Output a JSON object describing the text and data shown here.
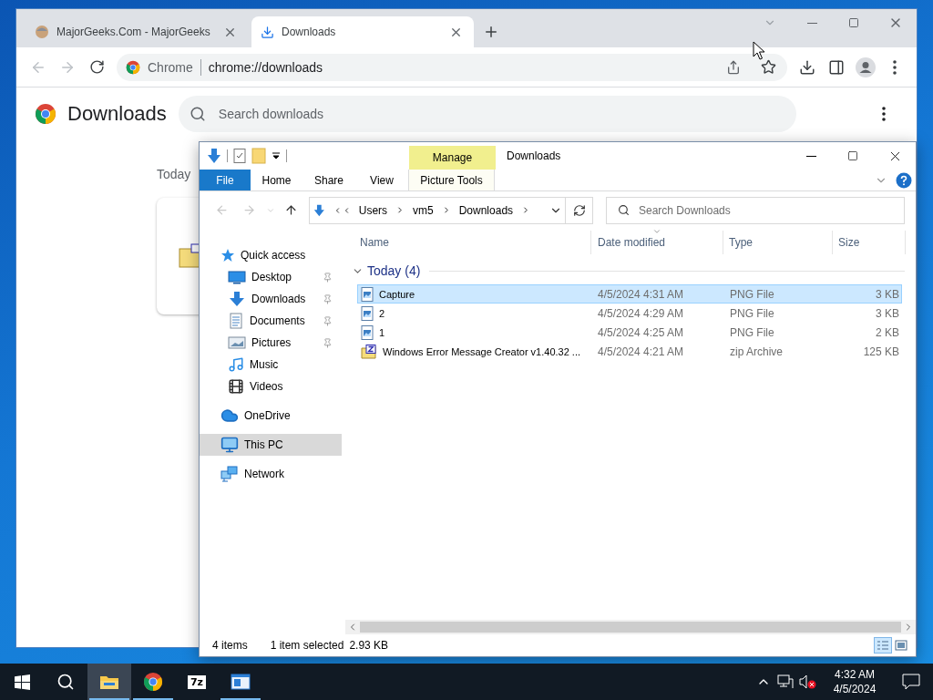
{
  "chrome": {
    "tabs": [
      {
        "title": "MajorGeeks.Com - MajorGeeks",
        "selected": false
      },
      {
        "title": "Downloads",
        "selected": true
      }
    ],
    "omnibox": {
      "site_label": "Chrome",
      "url": "chrome://downloads"
    },
    "page": {
      "title": "Downloads",
      "search_placeholder": "Search downloads",
      "section_label": "Today"
    }
  },
  "explorer": {
    "title": "Downloads",
    "contextual_group": "Manage",
    "ribbon_tabs": [
      {
        "label": "File",
        "kind": "file"
      },
      {
        "label": "Home",
        "kind": "plain"
      },
      {
        "label": "Share",
        "kind": "plain"
      },
      {
        "label": "View",
        "kind": "plain"
      },
      {
        "label": "Picture Tools",
        "kind": "contextual"
      }
    ],
    "breadcrumb": [
      "Users",
      "vm5",
      "Downloads"
    ],
    "search_placeholder": "Search Downloads",
    "navigation": [
      {
        "label": "Quick access",
        "selected": false,
        "children": [
          {
            "label": "Desktop",
            "selected": false,
            "pinned": true
          },
          {
            "label": "Downloads",
            "selected": false,
            "pinned": true
          },
          {
            "label": "Documents",
            "selected": false,
            "pinned": true
          },
          {
            "label": "Pictures",
            "selected": false,
            "pinned": true
          },
          {
            "label": "Music",
            "selected": false,
            "pinned": false
          },
          {
            "label": "Videos",
            "selected": false,
            "pinned": false
          }
        ]
      },
      {
        "label": "OneDrive",
        "selected": false
      },
      {
        "label": "This PC",
        "selected": true
      },
      {
        "label": "Network",
        "selected": false
      }
    ],
    "columns": [
      {
        "label": "Name",
        "sorted": false
      },
      {
        "label": "Date modified",
        "sorted": true
      },
      {
        "label": "Type",
        "sorted": false
      },
      {
        "label": "Size",
        "sorted": false
      }
    ],
    "groups": [
      {
        "label": "Today (4)",
        "expanded": true,
        "rows": [
          {
            "name": "Capture",
            "date": "4/5/2024 4:31 AM",
            "type": "PNG File",
            "size": "3 KB",
            "kind": "image",
            "selected": true
          },
          {
            "name": "2",
            "date": "4/5/2024 4:29 AM",
            "type": "PNG File",
            "size": "3 KB",
            "kind": "image",
            "selected": false
          },
          {
            "name": "1",
            "date": "4/5/2024 4:25 AM",
            "type": "PNG File",
            "size": "2 KB",
            "kind": "image",
            "selected": false
          },
          {
            "name": "Windows Error Message Creator v1.40.32 ...",
            "date": "4/5/2024 4:21 AM",
            "type": "zip Archive",
            "size": "125 KB",
            "kind": "archive",
            "selected": false
          }
        ]
      }
    ],
    "status": {
      "item_count": "4 items",
      "selection": "1 item selected",
      "selection_size": "2.93 KB"
    },
    "view_buttons": [
      {
        "selected": true
      },
      {
        "selected": false
      }
    ]
  },
  "taskbar": {
    "apps": [
      {
        "selected": true,
        "running": true
      },
      {
        "selected": false,
        "running": true
      },
      {
        "selected": false,
        "running": false,
        "badge": "7z"
      },
      {
        "selected": false,
        "running": true
      }
    ],
    "volume_muted": true,
    "clock": {
      "time": "4:32 AM",
      "date": "4/5/2024"
    }
  }
}
